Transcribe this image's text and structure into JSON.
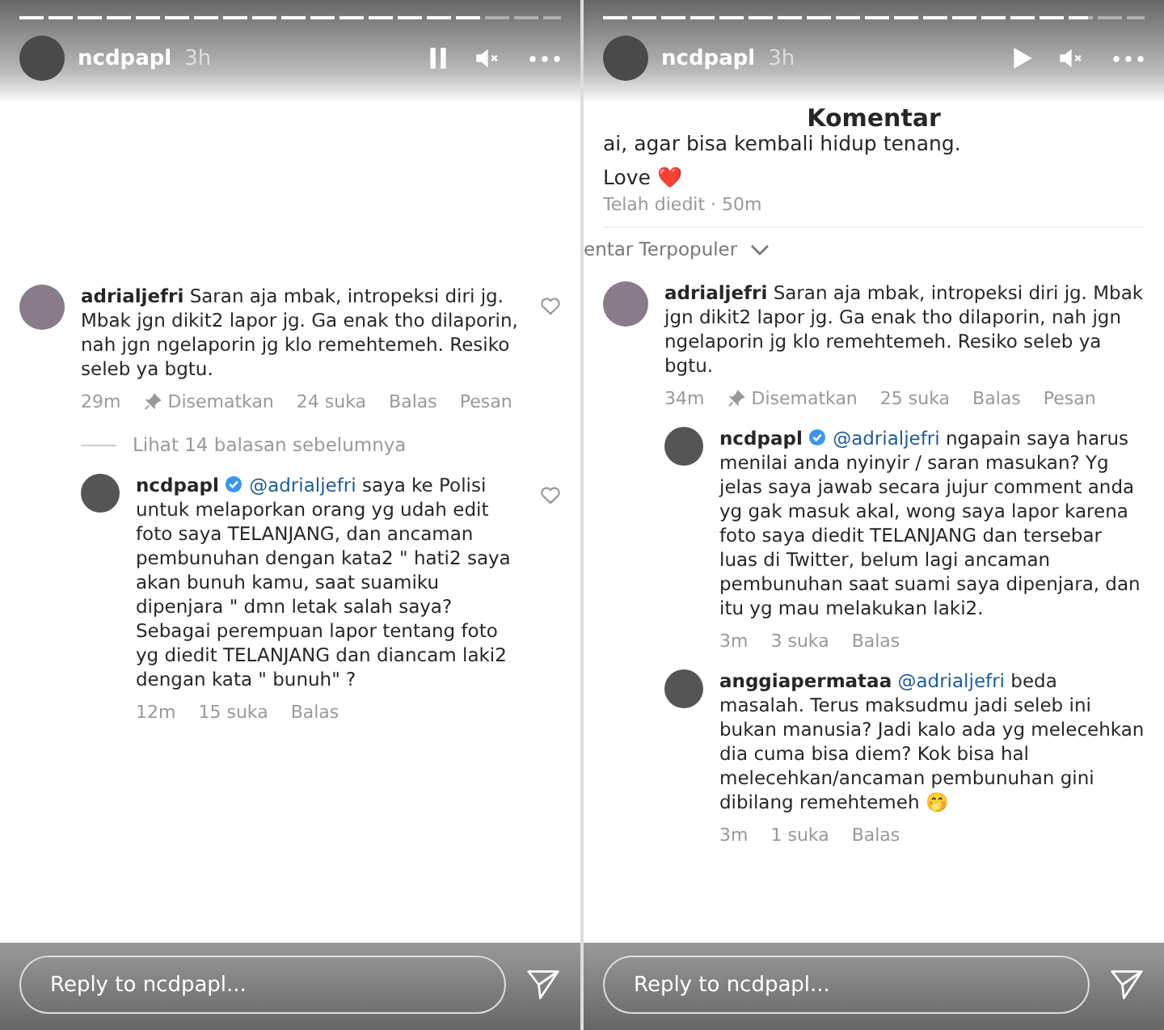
{
  "panels": [
    {
      "progress": {
        "level": 0.853
      },
      "user": "ncdpapl",
      "time": "3h",
      "paused": false,
      "muted": true,
      "comments": [
        {
          "author": "adrialjefri",
          "verified": false,
          "text": "Saran aja mbak, intropeksi diri jg. Mbak jgn dikit2 lapor jg. Ga enak tho dilaporin, nah jgn ngelaporin jg klo remehtemeh. Resiko seleb ya bgtu.",
          "show_like": true,
          "time": "29m",
          "pinned": true,
          "pinned_label": "Disematkan",
          "likes": "24 suka",
          "reply": "Balas",
          "message": "Pesan",
          "view_replies": "Lihat 14 balasan sebelumnya",
          "children": [
            {
              "author": "ncdpapl",
              "verified": true,
              "mention": "@adrialjefri",
              "text": "saya ke Polisi untuk melaporkan orang yg udah edit foto saya TELANJANG, dan ancaman pembunuhan dengan kata2 \" hati2 saya akan bunuh kamu, saat suamiku dipenjara \" dmn letak salah saya? Sebagai perempuan lapor tentang foto yg diedit TELANJANG dan diancam laki2 dengan kata \" bunuh\" ?",
              "show_like": true,
              "time": "12m",
              "pinned": false,
              "likes": "15 suka",
              "reply": "Balas"
            }
          ]
        }
      ],
      "reply_placeholder": "Reply to ncdpapl..."
    },
    {
      "progress": {
        "level": 0.895
      },
      "user": "ncdpapl",
      "time": "3h",
      "paused": true,
      "muted": true,
      "post": {
        "title": "Komentar",
        "caption": "ai, agar bisa kembali hidup tenang.",
        "love": "Love ❤️",
        "edited": "Telah diedit · 50m",
        "sort": "entar Terpopuler"
      },
      "comments": [
        {
          "author": "adrialjefri",
          "verified": false,
          "text": "Saran aja mbak, intropeksi diri jg. Mbak jgn dikit2 lapor jg. Ga enak tho dilaporin, nah jgn ngelaporin jg klo remehtemeh. Resiko seleb ya bgtu.",
          "show_like": false,
          "time": "34m",
          "pinned": true,
          "pinned_label": "Disematkan",
          "likes": "25 suka",
          "reply": "Balas",
          "message": "Pesan",
          "children": [
            {
              "author": "ncdpapl",
              "verified": true,
              "mention": "@adrialjefri",
              "text": "ngapain saya harus menilai anda nyinyir / saran masukan? Yg jelas saya jawab secara jujur comment anda yg gak masuk akal, wong saya lapor karena foto saya diedit TELANJANG dan tersebar luas di Twitter, belum lagi ancaman pembunuhan saat suami saya dipenjara, dan itu yg mau melakukan laki2.",
              "show_like": false,
              "time": "3m",
              "pinned": false,
              "likes": "3 suka",
              "reply": "Balas"
            },
            {
              "author": "anggiapermataa",
              "verified": false,
              "mention": "@adrialjefri",
              "text": "beda masalah. Terus maksudmu jadi seleb ini bukan manusia? Jadi kalo ada yg melecehkan dia cuma bisa diem? Kok bisa hal melecehkan/ancaman pembunuhan gini dibilang remehtemeh 🤭",
              "show_like": false,
              "time": "3m",
              "pinned": false,
              "likes": "1 suka",
              "reply": "Balas"
            }
          ]
        }
      ],
      "reply_placeholder": "Reply to ncdpapl..."
    }
  ]
}
